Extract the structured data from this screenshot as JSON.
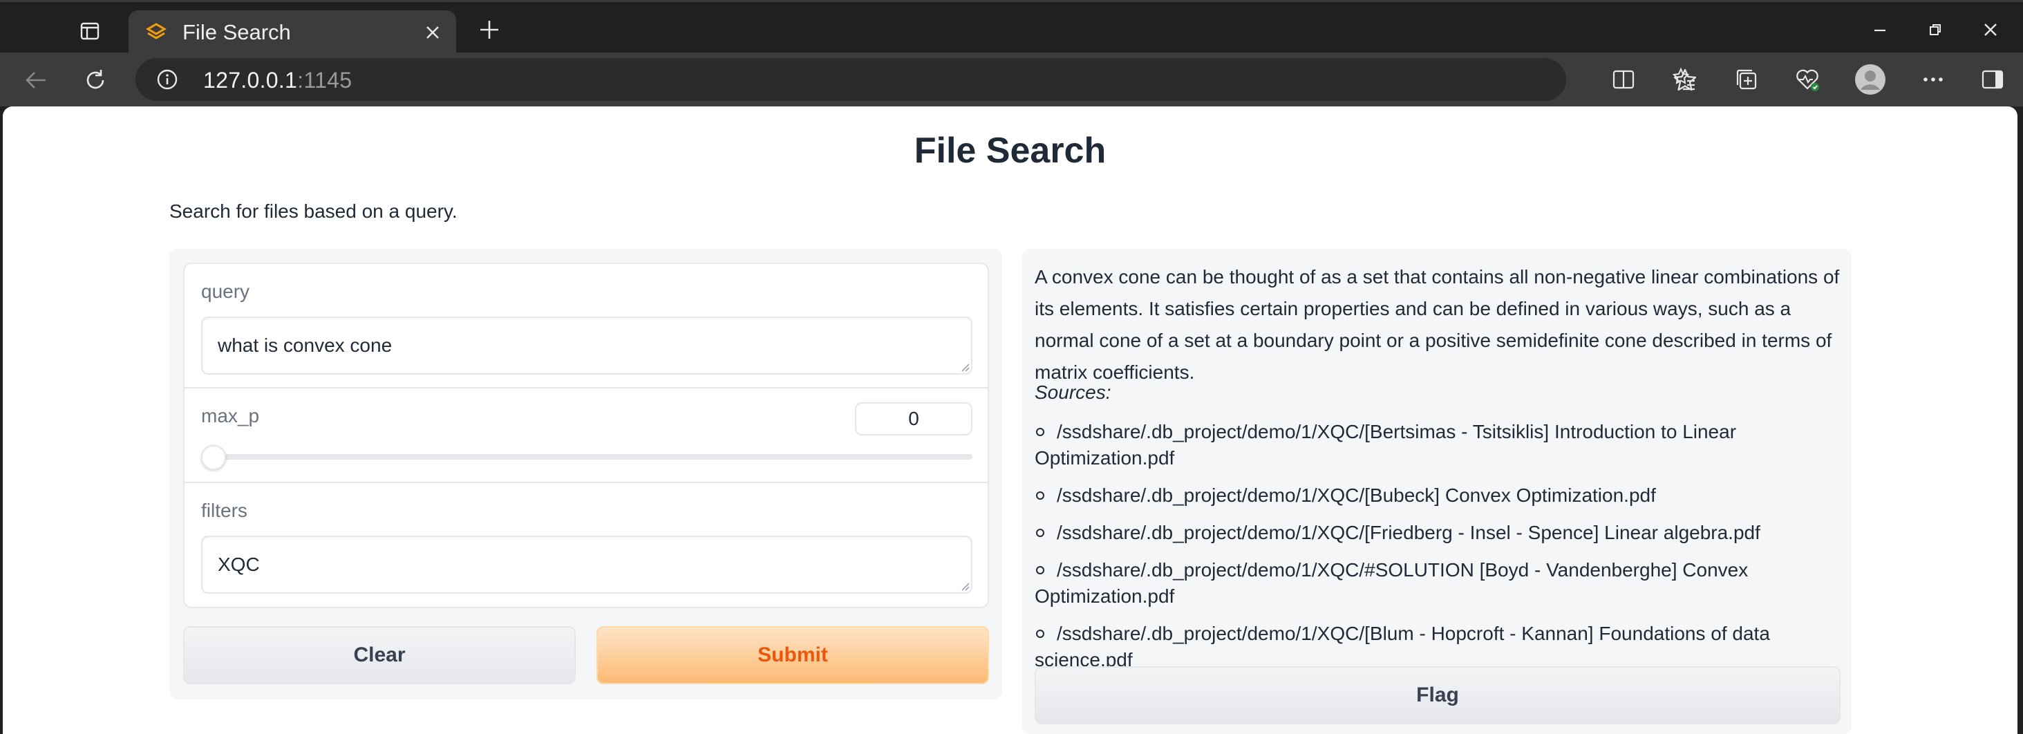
{
  "browser": {
    "tab_title": "File Search",
    "url_host": "127.0.0.1",
    "url_port": ":1145"
  },
  "page": {
    "title": "File Search",
    "description": "Search for files based on a query."
  },
  "form": {
    "query_label": "query",
    "query_value": "what is convex cone",
    "max_p_label": "max_p",
    "max_p_value": "0",
    "max_p_slider_fraction": 0,
    "filters_label": "filters",
    "filters_value": "XQC",
    "clear_label": "Clear",
    "submit_label": "Submit"
  },
  "output": {
    "answer": "A convex cone can be thought of as a set that contains all non-negative linear combinations of its elements. It satisfies certain properties and can be defined in various ways, such as a normal cone of a set at a boundary point or a positive semidefinite cone described in terms of matrix coefficients.",
    "sources_label": "Sources:",
    "sources": [
      "/ssdshare/.db_project/demo/1/XQC/[Bertsimas - Tsitsiklis] Introduction to Linear Optimization.pdf",
      "/ssdshare/.db_project/demo/1/XQC/[Bubeck] Convex Optimization.pdf",
      "/ssdshare/.db_project/demo/1/XQC/[Friedberg - Insel - Spence] Linear algebra.pdf",
      "/ssdshare/.db_project/demo/1/XQC/#SOLUTION [Boyd - Vandenberghe] Convex Optimization.pdf",
      "/ssdshare/.db_project/demo/1/XQC/[Blum - Hopcroft - Kannan] Foundations of data science.pdf"
    ],
    "flag_label": "Flag"
  },
  "colors": {
    "accent": "#ea580c",
    "submit_bg": "#fdba74",
    "chrome_bg": "#202020",
    "toolbar_bg": "#3c3c3c"
  }
}
